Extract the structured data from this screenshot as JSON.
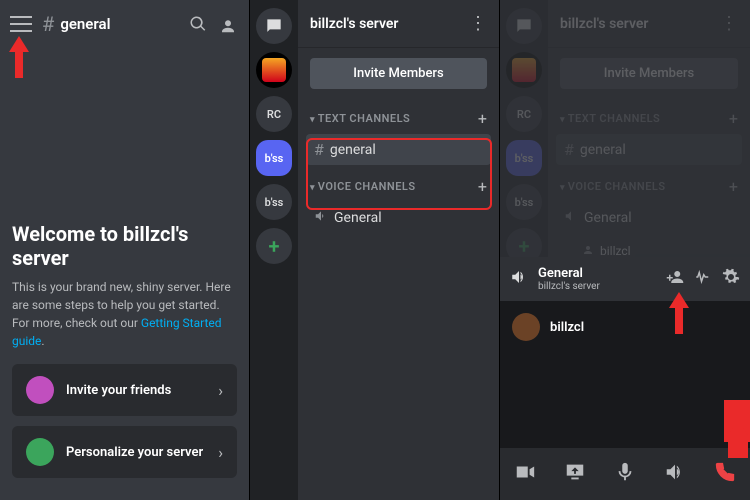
{
  "panel1": {
    "channel_name": "general",
    "welcome_heading": "Welcome to billzcl's server",
    "welcome_body_1": "This is your brand new, shiny server. Here are some steps to help you get started. For more, check out our ",
    "welcome_link": "Getting Started guide",
    "welcome_body_2": ".",
    "cards": [
      {
        "label": "Invite your friends"
      },
      {
        "label": "Personalize your server"
      }
    ]
  },
  "panel2": {
    "server_title": "billzcl's server",
    "invite_label": "Invite Members",
    "text_header": "TEXT CHANNELS",
    "voice_header": "VOICE CHANNELS",
    "text_channel": "general",
    "voice_channel": "General",
    "rail": [
      {
        "label": "",
        "kind": "dm"
      },
      {
        "label": "",
        "kind": "img1"
      },
      {
        "label": "RC",
        "kind": "rc"
      },
      {
        "label": "b'ss",
        "kind": "sel"
      },
      {
        "label": "b'ss",
        "kind": "bss2"
      },
      {
        "label": "+",
        "kind": "add"
      }
    ]
  },
  "panel3": {
    "server_title": "billzcl's server",
    "invite_label": "Invite Members",
    "text_header": "TEXT CHANNELS",
    "voice_header": "VOICE CHANNELS",
    "text_channel": "general",
    "voice_channel": "General",
    "vc_user_line": "billzcl",
    "vc_title": "General",
    "vc_sub": "billzcl's server",
    "username": "billzcl"
  }
}
